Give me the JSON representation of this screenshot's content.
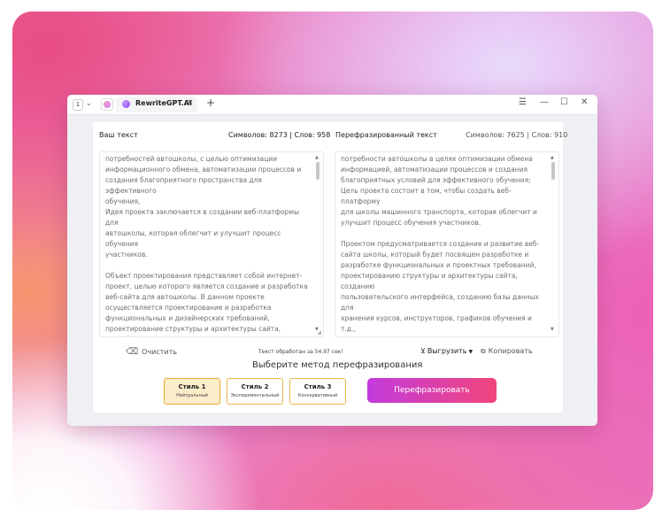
{
  "titlebar": {
    "tab_count": "1",
    "tab_title": "RewriteGPT.AI",
    "tab_close": "×",
    "new_tab": "+",
    "menu_icon": "☰",
    "minimize_icon": "—",
    "maximize_icon": "☐",
    "close_icon": "✕"
  },
  "left": {
    "title": "Ваш текст",
    "stats": "Символов: 8273 | Слов: 958",
    "paragraphs": [
      "потребностей автошколы, с целью оптимизации\nинформационного обмена, автоматизации процессов и\nсоздания благоприятного пространства для эффективного\nобучения,\nИдея проекта заключается в создании веб-платформы для\nавтошколы, которая облегчит и улучшит процесс обучения\nучастников.",
      "Объект проектирования представляет собой интернет-\nпроект, целью которого является создание и разработка\nвеб-сайта для автошколы. В данном проекте\nосуществляется проектирование и разработка\nфункциональных и дизайнерских требований,\nпроектирование структуры и архитектуры сайта, разработка\nпользовательского интерфейса, создание базы данных для\nхранения информации о курсах, инструкторах, расписании\nзанятий и т.д., разработка административной панели для"
    ]
  },
  "right": {
    "title": "Перефразированный текст",
    "stats": "Символов: 7625 | Слов: 910",
    "paragraphs": [
      "потребности автошколы в целях оптимизации обмена\nинформацией, автоматизации процессов и создания\nблагоприятных условий для эффективного обучения;\nЦель проекта состоит в том, чтобы создать веб-платформу\nдля школы машинного транспорта, которая облегчит и\nулучшит процесс обучения участников.",
      "Проектом предусматривается создание и развитие веб-\nсайта школы, который будет посвящен разработке и\nразработке функциональных и проектных требований,\nпроектированию структуры и архитектуры сайта, созданию\nпользовательского интерфейса, созданию базы данных для\nхранения курсов, инструкторов, графиков обучения и т.д.,\nсозданию административного совета по управлению\nинформационными ресурсами. Основные задачи проекта\nвключают в себя создание привлекательного и\nинтуитивного дизайна, обеспечение легкой навигации"
    ]
  },
  "actions": {
    "clear": "Очистить",
    "status": "Текст обработан за 54.97 сек!",
    "export": "Выгрузить",
    "copy": "Копировать"
  },
  "method": {
    "title": "Выберите метод перефразирования",
    "styles": [
      {
        "name": "Стиль 1",
        "desc": "Нейтральный"
      },
      {
        "name": "Стиль 2",
        "desc": "Экспериментальный"
      },
      {
        "name": "Стиль 3",
        "desc": "Консервативный"
      }
    ],
    "selected_index": 0,
    "submit": "Перефразировать"
  },
  "colors": {
    "accent_start": "#c23bdc",
    "accent_end": "#f2457c",
    "selected_style_bg": "#fbedc9",
    "style_border": "#e8b84a"
  }
}
